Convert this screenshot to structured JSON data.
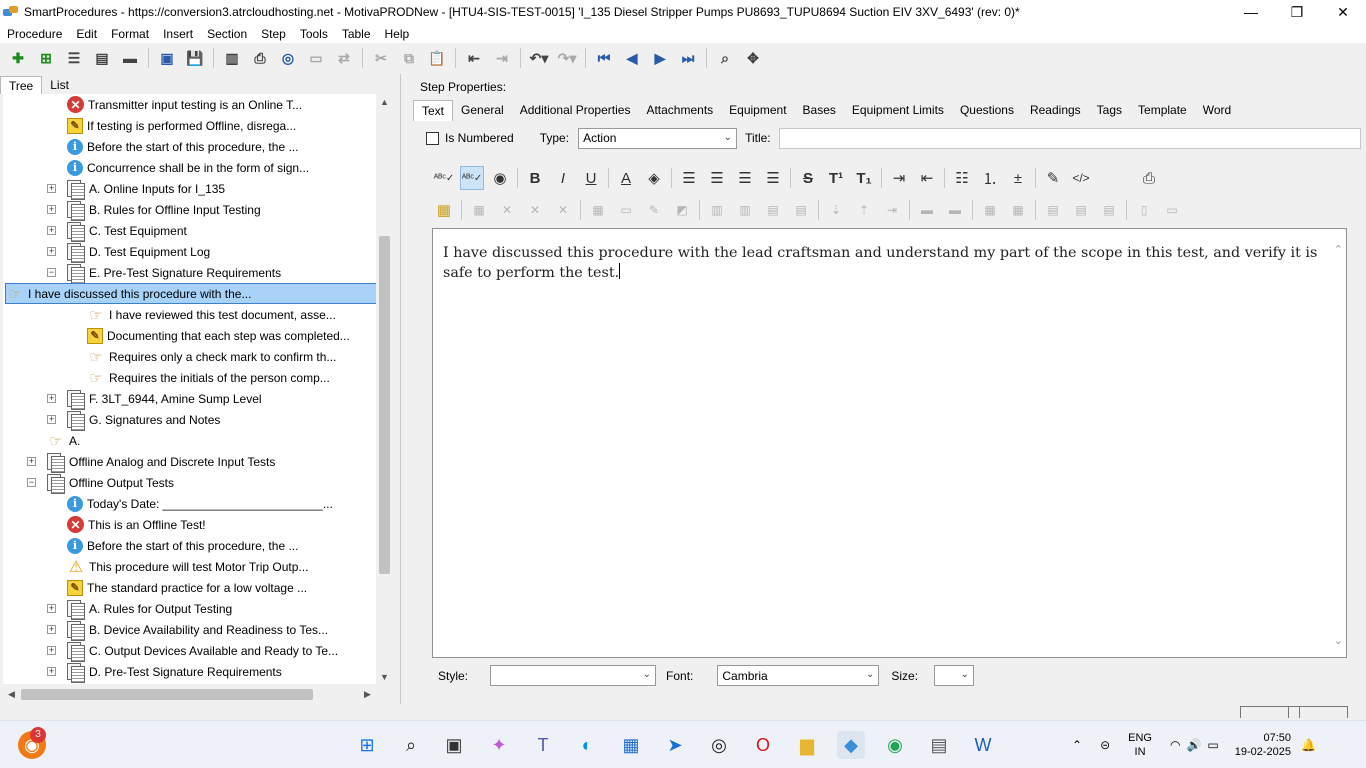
{
  "window": {
    "title": "SmartProcedures - https://conversion3.atrcloudhosting.net - MotivaPRODNew - [HTU4-SIS-TEST-0015] 'I_135 Diesel Stripper Pumps PU8693_TUPU8694 Suction EIV 3XV_6493' (rev: 0)*",
    "minimize": "—",
    "maximize": "❐",
    "close": "✕"
  },
  "menu": [
    "Procedure",
    "Edit",
    "Format",
    "Insert",
    "Section",
    "Step",
    "Tools",
    "Table",
    "Help"
  ],
  "left_tabs": [
    "Tree",
    "List"
  ],
  "tree": [
    {
      "icon": "error",
      "text": "Transmitter input testing is an Online T...",
      "indent": 1,
      "exp": ""
    },
    {
      "icon": "note",
      "text": "If testing is performed Offline, disrega...",
      "indent": 1,
      "exp": ""
    },
    {
      "icon": "info",
      "text": "Before the start of this procedure, the ...",
      "indent": 1,
      "exp": ""
    },
    {
      "icon": "info",
      "text": "Concurrence shall be in the form of sign...",
      "indent": 1,
      "exp": ""
    },
    {
      "icon": "section",
      "text": "A. Online Inputs for I_135",
      "indent": 1,
      "exp": "+"
    },
    {
      "icon": "section",
      "text": "B. Rules for Offline Input Testing",
      "indent": 1,
      "exp": "+"
    },
    {
      "icon": "section",
      "text": "C. Test Equipment",
      "indent": 1,
      "exp": "+"
    },
    {
      "icon": "section",
      "text": "D. Test Equipment Log",
      "indent": 1,
      "exp": "+"
    },
    {
      "icon": "section",
      "text": "E. Pre-Test Signature Requirements",
      "indent": 1,
      "exp": "−"
    },
    {
      "icon": "action",
      "text": "I have discussed this procedure with the...",
      "indent": 2,
      "exp": "",
      "selected": true
    },
    {
      "icon": "action",
      "text": "I have reviewed this test document, asse...",
      "indent": 2,
      "exp": ""
    },
    {
      "icon": "note",
      "text": "Documenting that each step was completed...",
      "indent": 2,
      "exp": ""
    },
    {
      "icon": "action",
      "text": "Requires only a check mark to confirm th...",
      "indent": 2,
      "exp": ""
    },
    {
      "icon": "action",
      "text": "Requires the initials of the person comp...",
      "indent": 2,
      "exp": ""
    },
    {
      "icon": "section",
      "text": "F. 3LT_6944, Amine Sump Level",
      "indent": 1,
      "exp": "+"
    },
    {
      "icon": "section",
      "text": "G. Signatures and Notes",
      "indent": 1,
      "exp": "+"
    },
    {
      "icon": "action",
      "text": "A.",
      "indent": 0,
      "exp": ""
    },
    {
      "icon": "section",
      "text": "Offline Analog and Discrete Input Tests",
      "indent": 0,
      "exp": "+"
    },
    {
      "icon": "section",
      "text": "Offline Output Tests",
      "indent": 0,
      "exp": "−"
    },
    {
      "icon": "info",
      "text": "Today's Date: ________________________...",
      "indent": 1,
      "exp": ""
    },
    {
      "icon": "error",
      "text": "This is an Offline Test!",
      "indent": 1,
      "exp": ""
    },
    {
      "icon": "info",
      "text": "Before the start of this procedure, the ...",
      "indent": 1,
      "exp": ""
    },
    {
      "icon": "warning",
      "text": "This procedure will test Motor Trip Outp...",
      "indent": 1,
      "exp": ""
    },
    {
      "icon": "note",
      "text": "The standard practice for a low voltage ...",
      "indent": 1,
      "exp": ""
    },
    {
      "icon": "section",
      "text": "A. Rules for Output Testing",
      "indent": 1,
      "exp": "+"
    },
    {
      "icon": "section",
      "text": "B. Device Availability and Readiness to Tes...",
      "indent": 1,
      "exp": "+"
    },
    {
      "icon": "section",
      "text": "C. Output Devices Available and Ready to Te...",
      "indent": 1,
      "exp": "+"
    },
    {
      "icon": "section",
      "text": "D. Pre-Test Signature Requirements",
      "indent": 1,
      "exp": "+"
    }
  ],
  "step_properties": {
    "label": "Step Properties:",
    "tabs": [
      "Text",
      "General",
      "Additional Properties",
      "Attachments",
      "Equipment",
      "Bases",
      "Equipment Limits",
      "Questions",
      "Readings",
      "Tags",
      "Template",
      "Word"
    ],
    "is_numbered_label": "Is Numbered",
    "type_label": "Type:",
    "type_value": "Action",
    "title_label": "Title:",
    "title_value": "",
    "editor_text": "I have discussed this procedure with the lead craftsman and understand my part of the scope in this test, and verify it is safe to perform the test.",
    "style_label": "Style:",
    "style_value": "",
    "font_label": "Font:",
    "font_value": "Cambria",
    "size_label": "Size:",
    "size_value": ""
  },
  "taskbar": {
    "notification_badge": "3",
    "language": "ENG",
    "region": "IN",
    "time": "07:50",
    "date": "19-02-2025"
  }
}
